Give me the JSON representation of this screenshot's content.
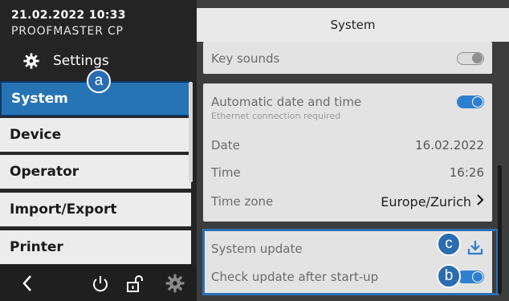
{
  "status": {
    "datetime": "21.02.2022 10:33",
    "device": "PROOFMASTER CP"
  },
  "sidebar": {
    "title": "Settings",
    "title_icon": "gear-icon",
    "items": [
      {
        "label": "System",
        "active": true
      },
      {
        "label": "Device"
      },
      {
        "label": "Operator"
      },
      {
        "label": "Import/Export"
      },
      {
        "label": "Printer"
      }
    ]
  },
  "bottom_bar": {
    "icons": [
      "back-chevron-icon",
      "power-icon",
      "unlock-icon",
      "gear-icon"
    ]
  },
  "header": {
    "title": "System"
  },
  "rows": {
    "key_sounds": {
      "label": "Key sounds",
      "enabled": false
    },
    "auto_datetime": {
      "label": "Automatic date and time",
      "sub": "Ethernet connection required",
      "enabled": true
    },
    "date": {
      "label": "Date",
      "value": "16.02.2022"
    },
    "time": {
      "label": "Time",
      "value": "16:26"
    },
    "timezone": {
      "label": "Time zone",
      "value": "Europe/Zurich"
    },
    "system_update": {
      "label": "System update",
      "icon": "download-icon"
    },
    "check_update": {
      "label": "Check update after start-up",
      "enabled": true
    }
  },
  "callouts": {
    "a": "a",
    "b": "b",
    "c": "c"
  },
  "colors": {
    "accent": "#2774b5",
    "toggle_on": "#2f7fd0",
    "dark_bg": "#242424"
  }
}
